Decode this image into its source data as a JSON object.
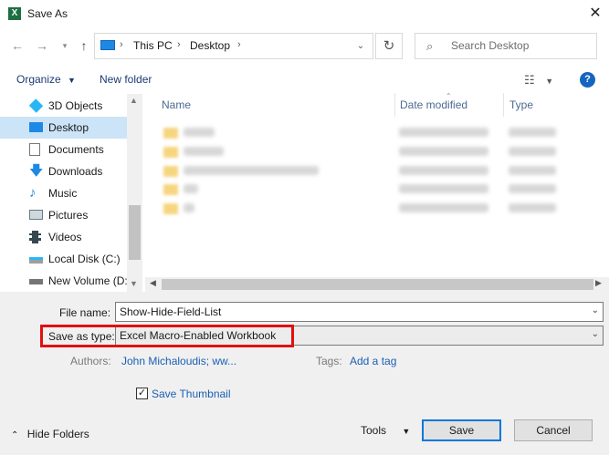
{
  "window": {
    "title": "Save As",
    "app_icon_letter": "X"
  },
  "nav": {
    "breadcrumbs": [
      "This PC",
      "Desktop"
    ],
    "search_placeholder": "Search Desktop"
  },
  "commandbar": {
    "organize": "Organize",
    "new_folder": "New folder"
  },
  "sidebar": {
    "items": [
      {
        "label": "3D Objects",
        "icon": "3d-objects-icon"
      },
      {
        "label": "Desktop",
        "icon": "desktop-icon",
        "selected": true
      },
      {
        "label": "Documents",
        "icon": "documents-icon"
      },
      {
        "label": "Downloads",
        "icon": "downloads-icon"
      },
      {
        "label": "Music",
        "icon": "music-icon"
      },
      {
        "label": "Pictures",
        "icon": "pictures-icon"
      },
      {
        "label": "Videos",
        "icon": "videos-icon"
      },
      {
        "label": "Local Disk (C:)",
        "icon": "drive-icon"
      },
      {
        "label": "New Volume (D:",
        "icon": "drive-icon"
      }
    ]
  },
  "filelist": {
    "columns": [
      "Name",
      "Date modified",
      "Type"
    ],
    "rows_blurred": 5
  },
  "form": {
    "file_name_label": "File name:",
    "file_name_value": "Show-Hide-Field-List",
    "save_type_label": "Save as type:",
    "save_type_value": "Excel Macro-Enabled Workbook",
    "authors_label": "Authors:",
    "authors_value": "John Michaloudis; ww...",
    "tags_label": "Tags:",
    "tags_value": "Add a tag",
    "thumbnail_label": "Save Thumbnail",
    "thumbnail_checked": true
  },
  "footer": {
    "hide_folders": "Hide Folders",
    "tools": "Tools",
    "save": "Save",
    "cancel": "Cancel"
  },
  "colors": {
    "accent": "#0078d7",
    "highlight_box": "#e01010",
    "selected_bg": "#cce4f7"
  }
}
